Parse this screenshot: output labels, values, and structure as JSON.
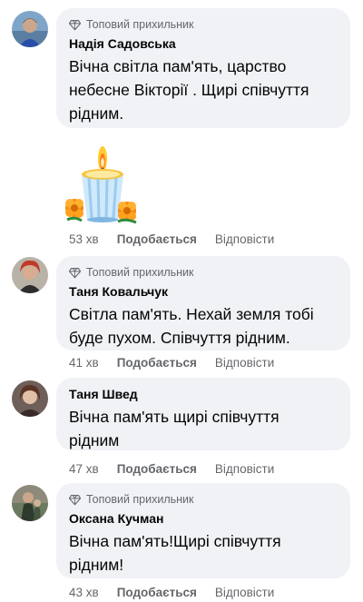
{
  "comments": [
    {
      "badge": "Топовий прихильник",
      "author": "Надія Садовська",
      "lines": [
        "Вічна світла пам'ять, царство",
        "небесне Вікторії . Щирі співчуття",
        "рідним."
      ],
      "time": "53 хв",
      "like": "Подобається",
      "reply": "Відповісти"
    },
    {
      "badge": "Топовий прихильник",
      "author": "Таня Ковальчук",
      "lines": [
        "Світла пам'ять. Нехай земля тобі",
        "буде пухом. Співчуття рідним."
      ],
      "time": "41 хв",
      "like": "Подобається",
      "reply": "Відповісти"
    },
    {
      "author": "Таня Швед",
      "lines": [
        "Вічна пам'ять щирі співчуття",
        "рідним"
      ],
      "time": "47 хв",
      "like": "Подобається",
      "reply": "Відповісти"
    },
    {
      "badge": "Топовий прихильник",
      "author": "Оксана Кучман",
      "lines": [
        "Вічна пам'ять!Щирі співчуття",
        "рідним!"
      ],
      "time": "43 хв",
      "like": "Подобається",
      "reply": "Відповісти"
    }
  ],
  "icons": {
    "badge": "diamond-icon",
    "sticker": "memorial-candle-sticker"
  }
}
